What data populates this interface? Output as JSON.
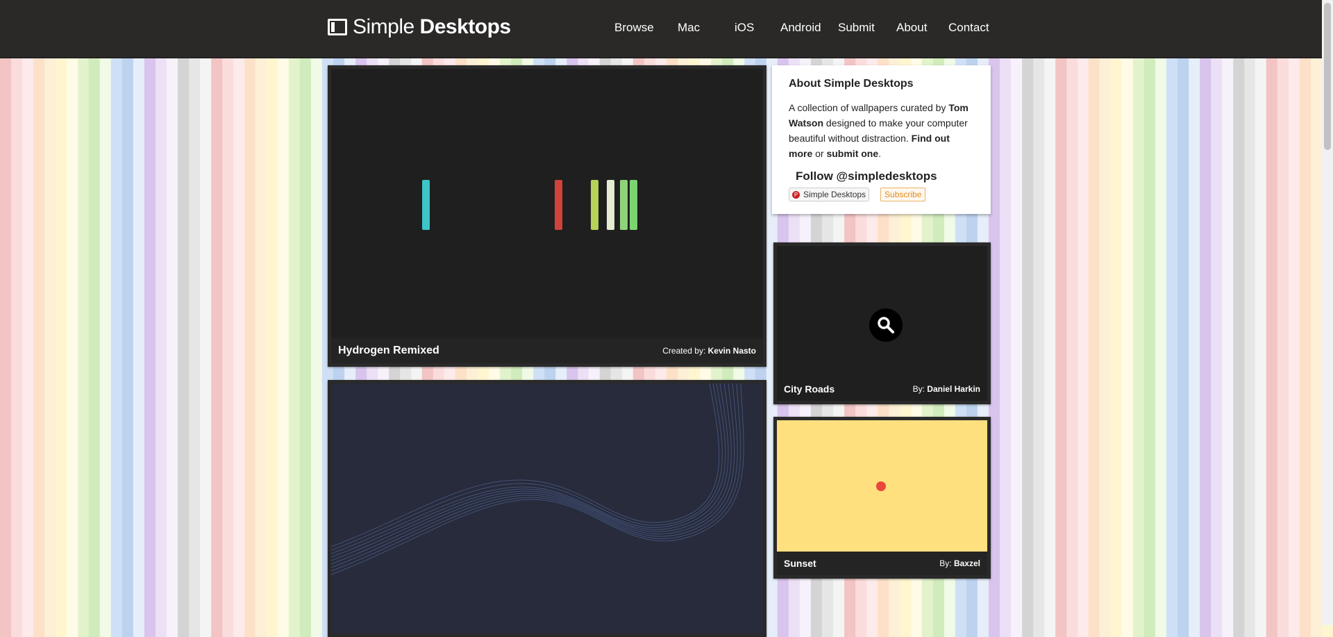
{
  "header": {
    "logo_light": "Simple",
    "logo_bold": "Desktops",
    "nav": [
      "Browse",
      "Mac",
      "iOS",
      "Android",
      "Submit",
      "About",
      "Contact"
    ]
  },
  "featured": [
    {
      "title": "Hydrogen Remixed",
      "by_label": "Created by:",
      "author": "Kevin Nasto"
    },
    {
      "title": "",
      "by_label": "",
      "author": ""
    }
  ],
  "about": {
    "heading": "About Simple Desktops",
    "text1": "A collection of wallpapers curated by ",
    "author": "Tom Watson",
    "text2": " designed to make your computer beautiful without distraction. ",
    "find_out_more": "Find out more",
    "text3": " or ",
    "submit_one": "submit one",
    "text4": ".",
    "follow": "Follow @simpledesktops",
    "pinterest": "Simple Desktops",
    "subscribe": "Subscribe"
  },
  "side": [
    {
      "title": "City Roads",
      "by_label": "By:",
      "author": "Daniel Harkin"
    },
    {
      "title": "Sunset",
      "by_label": "By:",
      "author": "Baxzel"
    }
  ],
  "colors": {
    "header_bg": "#2a2928",
    "card_bg": "#1f1f1f",
    "sunset_bg": "#ffe07f",
    "sunset_dot": "#e8483c"
  }
}
